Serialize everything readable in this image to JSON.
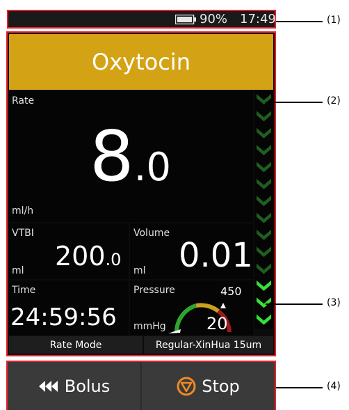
{
  "status_bar": {
    "battery": "90%",
    "time": "17:49",
    "battery_icon": "battery-icon"
  },
  "header": {
    "drug_name": "Oxytocin",
    "color": "#d4a215"
  },
  "rate": {
    "label": "Rate",
    "value_int": "8",
    "value_dec": ".0",
    "unit": "ml/h"
  },
  "vtbi": {
    "label": "VTBI",
    "value_int": "200",
    "value_dec": ".0",
    "unit": "ml"
  },
  "volume": {
    "label": "Volume",
    "value": "0.01",
    "unit": "ml"
  },
  "time": {
    "label": "Time",
    "value": "24:59:56"
  },
  "pressure": {
    "label": "Pressure",
    "value": "20",
    "max": "450",
    "unit": "mmHg"
  },
  "mode": {
    "rate_mode": "Rate Mode",
    "syringe": "Regular-XinHua 15um"
  },
  "buttons": {
    "bolus": "Bolus",
    "stop": "Stop",
    "stop_icon_color": "#f08a24"
  },
  "drip_indicator": {
    "total_chevrons": 14,
    "active_chevrons": 3,
    "inactive_color": "#1f5e1f",
    "active_color": "#36e03a"
  },
  "callouts": {
    "c1": "(1)",
    "c2": "(2)",
    "c3": "(3)",
    "c4": "(4)"
  },
  "accent": "#e8202a"
}
